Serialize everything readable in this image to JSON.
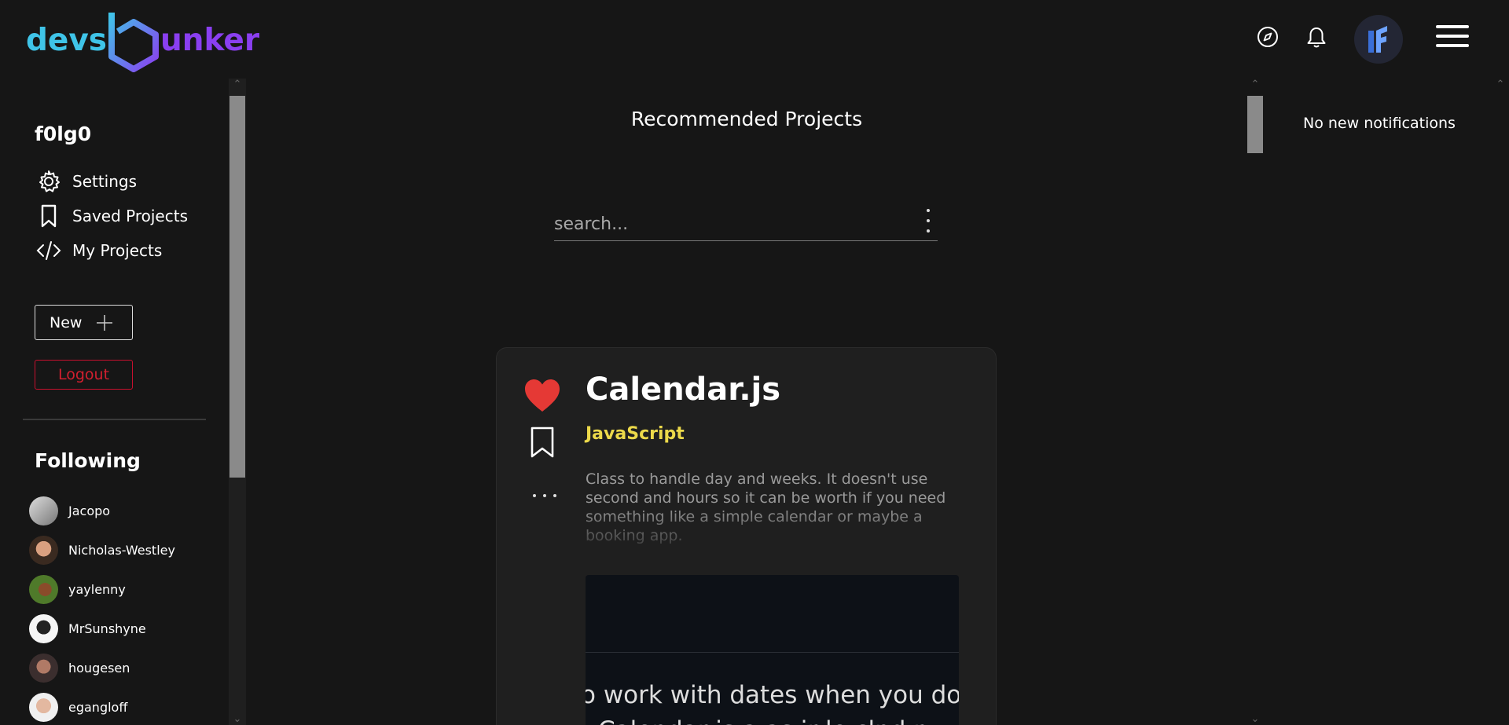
{
  "brand": {
    "part1": "devs",
    "part2": "unker"
  },
  "header": {
    "explore_icon": "compass-icon",
    "notifications_icon": "bell-icon",
    "avatar_initials": "F",
    "menu_icon": "hamburger-icon"
  },
  "sidebar": {
    "username": "f0lg0",
    "menu": [
      {
        "label": "Settings",
        "icon": "gear-icon"
      },
      {
        "label": "Saved Projects",
        "icon": "bookmark-icon"
      },
      {
        "label": "My Projects",
        "icon": "code-icon"
      }
    ],
    "new_label": "New",
    "logout_label": "Logout",
    "following_title": "Following",
    "following": [
      {
        "name": "Jacopo"
      },
      {
        "name": "Nicholas-Westley"
      },
      {
        "name": "yaylenny"
      },
      {
        "name": "MrSunshyne"
      },
      {
        "name": "hougesen"
      },
      {
        "name": "egangloff"
      }
    ]
  },
  "main": {
    "title": "Recommended Projects",
    "search_placeholder": "search...",
    "card": {
      "title": "Calendar.js",
      "language": "JavaScript",
      "language_color": "#ecd94a",
      "description": "Class to handle day and weeks. It doesn't use second and hours so it can be worth if you need something like a simple calendar or maybe a booking app.",
      "preview_line1": "o work with dates when you don't wa",
      "preview_line2": "t Calendar is a as ir le clnd r"
    }
  },
  "notifications": {
    "empty_text": "No new notifications"
  },
  "colors": {
    "background": "#161616",
    "accent_cyan": "#3fc4e8",
    "accent_purple": "#8a3ff0",
    "heart": "#e53935",
    "logout": "#d21f2f"
  }
}
